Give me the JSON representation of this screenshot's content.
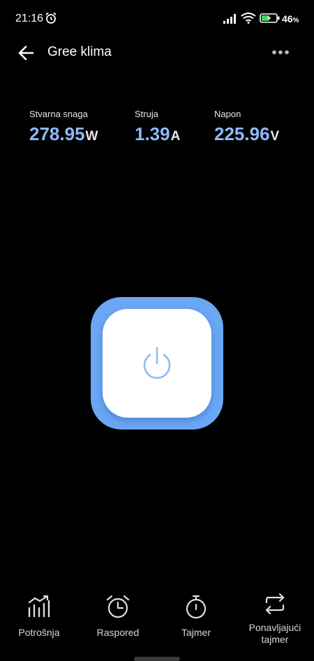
{
  "status_bar": {
    "time": "21:16",
    "battery_percent": "46",
    "battery_suffix": "%"
  },
  "header": {
    "title": "Gree klima"
  },
  "metrics": [
    {
      "label": "Stvarna snaga",
      "value": "278.95",
      "unit": "W"
    },
    {
      "label": "Struja",
      "value": "1.39",
      "unit": "A"
    },
    {
      "label": "Napon",
      "value": "225.96",
      "unit": "V"
    }
  ],
  "power": {
    "icon": "power-icon",
    "accent": "#6aa7f5"
  },
  "nav": [
    {
      "label": "Potrošnja",
      "icon": "bar-chart-icon"
    },
    {
      "label": "Raspored",
      "icon": "alarm-clock-icon"
    },
    {
      "label": "Tajmer",
      "icon": "stopwatch-icon"
    },
    {
      "label_line1": "Ponavljajući",
      "label_line2": "tajmer",
      "icon": "repeat-icon"
    }
  ],
  "colors": {
    "background": "#000000",
    "value_blue": "#8fb9f6",
    "button_blue": "#6aa7f5"
  }
}
